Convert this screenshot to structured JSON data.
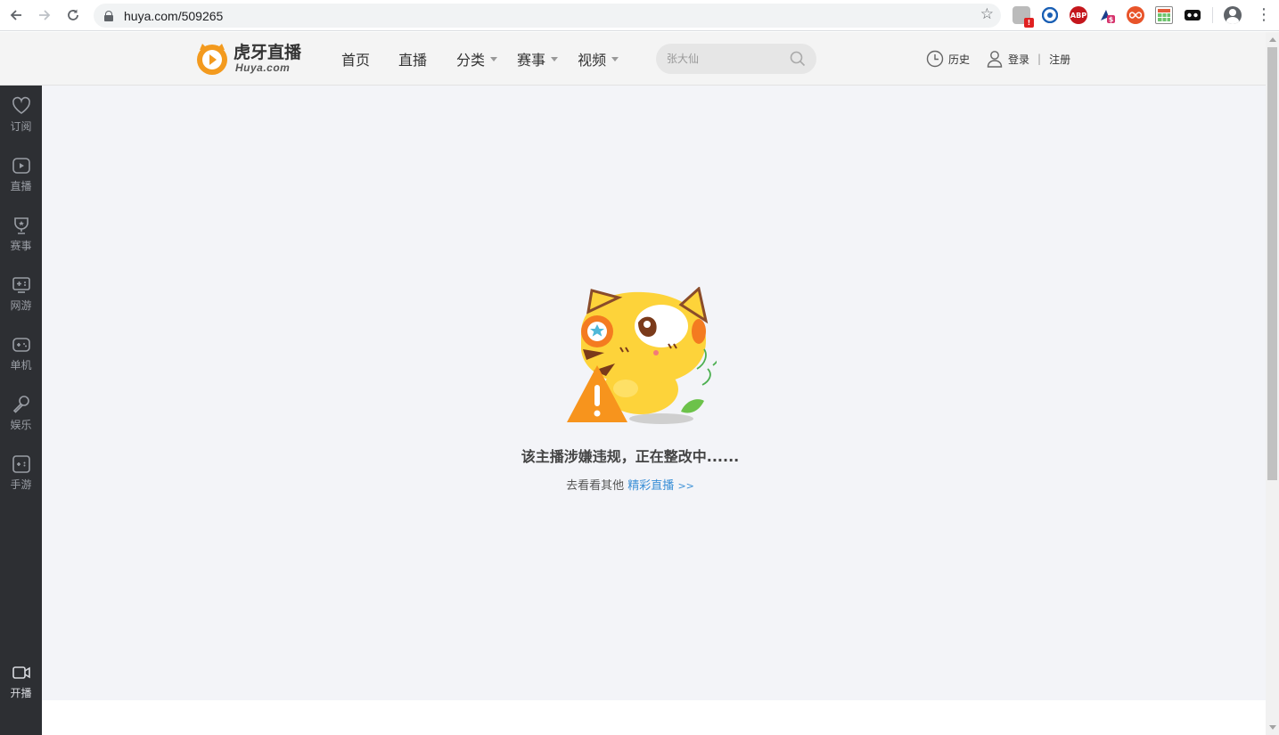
{
  "browser": {
    "url": "huya.com/509265",
    "extensions": [
      "extension-red-badge-icon",
      "github-cat-icon",
      "adblock-abp-icon",
      "wizard-dollar-icon",
      "infinity-icon",
      "table-grid-icon",
      "mask-icon"
    ],
    "abp_label": "ABP"
  },
  "header": {
    "logo_text": "虎牙直播",
    "logo_sub": "Huya.com",
    "nav": [
      {
        "label": "首页"
      },
      {
        "label": "直播"
      },
      {
        "label": "分类"
      },
      {
        "label": "赛事"
      },
      {
        "label": "视频"
      }
    ],
    "search_placeholder": "张大仙",
    "history_label": "历史",
    "login_label": "登录",
    "divider": "|",
    "register_label": "注册"
  },
  "sidebar": {
    "items": [
      {
        "label": "订阅",
        "icon": "heart-icon"
      },
      {
        "label": "直播",
        "icon": "tv-play-icon"
      },
      {
        "label": "赛事",
        "icon": "trophy-icon"
      },
      {
        "label": "网游",
        "icon": "gamepad-pc-icon"
      },
      {
        "label": "单机",
        "icon": "controller-icon"
      },
      {
        "label": "娱乐",
        "icon": "microphone-icon"
      },
      {
        "label": "手游",
        "icon": "mobile-game-icon"
      }
    ],
    "broadcast_label": "开播"
  },
  "notice": {
    "title": "该主播涉嫌违规，正在整改中......",
    "sub_prefix": "去看看其他",
    "link_label": "精彩直播",
    "link_suffix": ">>"
  },
  "colors": {
    "sidebar_bg": "#2d2f33",
    "main_bg": "#f3f4f8",
    "link": "#3a8fd6",
    "logo_orange": "#f39a1e"
  }
}
